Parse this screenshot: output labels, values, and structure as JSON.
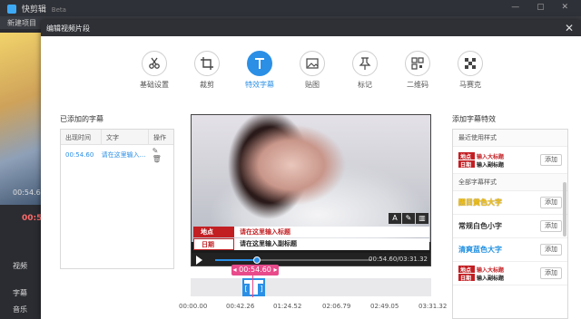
{
  "app": {
    "title": "快剪辑",
    "title_suffix": "Beta",
    "toolbar_label": "新建项目",
    "preview_time": "00:54.60",
    "elapsed": "00:55",
    "side_items": [
      "视频",
      "字幕",
      "音乐"
    ]
  },
  "dialog": {
    "title": "编辑视频片段",
    "close": "✕",
    "tabs": [
      {
        "label": "基础设置",
        "icon": "scissors-icon",
        "active": false
      },
      {
        "label": "裁剪",
        "icon": "crop-icon",
        "active": false
      },
      {
        "label": "特效字幕",
        "icon": "text-icon",
        "active": true
      },
      {
        "label": "贴图",
        "icon": "image-icon",
        "active": false
      },
      {
        "label": "标记",
        "icon": "pin-icon",
        "active": false
      },
      {
        "label": "二维码",
        "icon": "qrcode-icon",
        "active": false
      },
      {
        "label": "马赛克",
        "icon": "mosaic-icon",
        "active": false
      }
    ]
  },
  "subtitles": {
    "section_title": "已添加的字幕",
    "columns": [
      "出现时间",
      "文字",
      "操作"
    ],
    "rows": [
      {
        "time": "00:54.60",
        "text": "请在这里输入..."
      }
    ]
  },
  "video": {
    "caption_tag1": "地点",
    "caption_text1": "请在这里输入标题",
    "caption_tag2": "日期",
    "caption_text2": "请在这里输入副标题",
    "time_display": "00:54.60/03:31.32",
    "progress": 0.27
  },
  "timeline": {
    "marker": "00:54.60",
    "clip_left": "[",
    "clip_right": "]",
    "ticks": [
      "00:00.00",
      "00:42.26",
      "01:24.52",
      "02:06.79",
      "02:49.05",
      "03:31.32"
    ]
  },
  "effects": {
    "section_title": "添加字幕特效",
    "recent_label": "最近使用样式",
    "all_label": "全部字幕样式",
    "add_label": "添加",
    "mini_tag1": "地点",
    "mini_text1": "输入大标题",
    "mini_tag2": "日期",
    "mini_text2": "输入副标题",
    "styles": [
      {
        "name": "醒目黄色大字",
        "color": "#f2c21b"
      },
      {
        "name": "常规白色小字",
        "color": "#333333"
      },
      {
        "name": "清爽蓝色大字",
        "color": "#1e8fe0"
      }
    ]
  }
}
